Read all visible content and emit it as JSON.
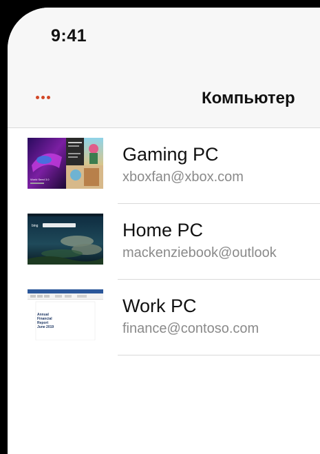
{
  "status_bar": {
    "time": "9:41"
  },
  "nav": {
    "title": "Компьютер",
    "more_icon": "more-dots-icon",
    "accent_color": "#d24726"
  },
  "devices": [
    {
      "name": "Gaming PC",
      "email": "xboxfan@xbox.com",
      "thumbnail": "xbox-desktop-thumbnail",
      "thumb_caption": "World Seed 3.0"
    },
    {
      "name": "Home PC",
      "email": "mackenziebook@outlook",
      "thumbnail": "bing-desktop-thumbnail",
      "thumb_caption": "bing"
    },
    {
      "name": "Work PC",
      "email": "finance@contoso.com",
      "thumbnail": "word-document-thumbnail",
      "thumb_caption": "Annual Financial Report June 2019"
    }
  ]
}
